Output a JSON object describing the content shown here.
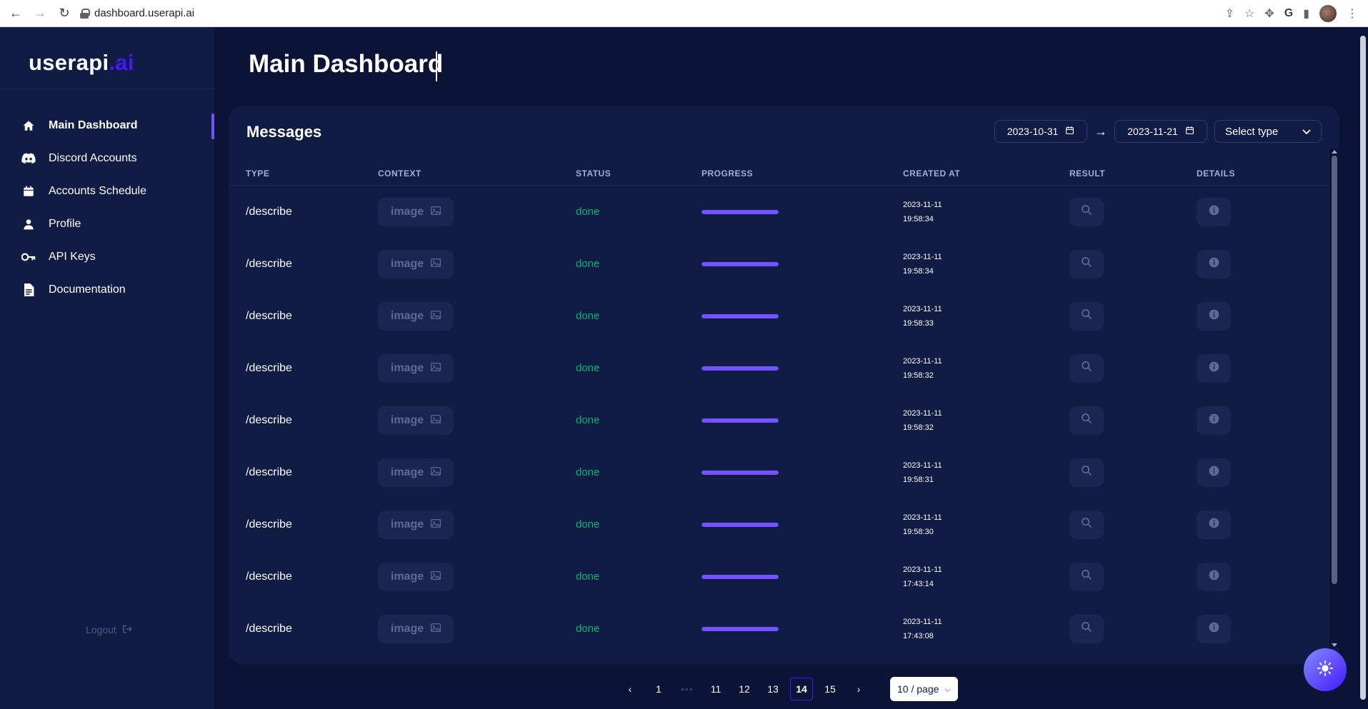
{
  "browser": {
    "url": "dashboard.userapi.ai"
  },
  "sidebar": {
    "logo": {
      "main": "userapi",
      "accent": ".ai"
    },
    "items": [
      {
        "label": "Main Dashboard",
        "icon": "home-icon",
        "active": true
      },
      {
        "label": "Discord Accounts",
        "icon": "discord-icon",
        "active": false
      },
      {
        "label": "Accounts Schedule",
        "icon": "calendar-icon",
        "active": false
      },
      {
        "label": "Profile",
        "icon": "person-icon",
        "active": false
      },
      {
        "label": "API Keys",
        "icon": "key-icon",
        "active": false
      },
      {
        "label": "Documentation",
        "icon": "document-icon",
        "active": false
      }
    ],
    "logout_label": "Logout"
  },
  "main": {
    "title": "Main Dashboard"
  },
  "messages": {
    "title": "Messages",
    "date_from": "2023-10-31",
    "date_to": "2023-11-21",
    "select_type_placeholder": "Select type",
    "columns": [
      "TYPE",
      "CONTEXT",
      "STATUS",
      "PROGRESS",
      "CREATED AT",
      "RESULT",
      "DETAILS"
    ],
    "rows": [
      {
        "type": "/describe",
        "context": "image",
        "status": "done",
        "progress": 1.0,
        "date": "2023-11-11",
        "time": "19:58:34"
      },
      {
        "type": "/describe",
        "context": "image",
        "status": "done",
        "progress": 1.0,
        "date": "2023-11-11",
        "time": "19:58:34"
      },
      {
        "type": "/describe",
        "context": "image",
        "status": "done",
        "progress": 1.0,
        "date": "2023-11-11",
        "time": "19:58:33"
      },
      {
        "type": "/describe",
        "context": "image",
        "status": "done",
        "progress": 1.0,
        "date": "2023-11-11",
        "time": "19:58:32"
      },
      {
        "type": "/describe",
        "context": "image",
        "status": "done",
        "progress": 1.0,
        "date": "2023-11-11",
        "time": "19:58:32"
      },
      {
        "type": "/describe",
        "context": "image",
        "status": "done",
        "progress": 1.0,
        "date": "2023-11-11",
        "time": "19:58:31"
      },
      {
        "type": "/describe",
        "context": "image",
        "status": "done",
        "progress": 1.0,
        "date": "2023-11-11",
        "time": "19:58:30"
      },
      {
        "type": "/describe",
        "context": "image",
        "status": "done",
        "progress": 1.0,
        "date": "2023-11-11",
        "time": "17:43:14"
      },
      {
        "type": "/describe",
        "context": "image",
        "status": "done",
        "progress": 1.0,
        "date": "2023-11-11",
        "time": "17:43:08"
      }
    ]
  },
  "pagination": {
    "prev": "‹",
    "next": "›",
    "pages": [
      "1",
      "•••",
      "11",
      "12",
      "13",
      "14",
      "15"
    ],
    "current": "14",
    "page_size": "10 / page"
  },
  "colors": {
    "background": "#0b1437",
    "card": "#111c44",
    "accent": "#4318ff",
    "progress": "#7551ff",
    "status_done": "#01b574"
  }
}
